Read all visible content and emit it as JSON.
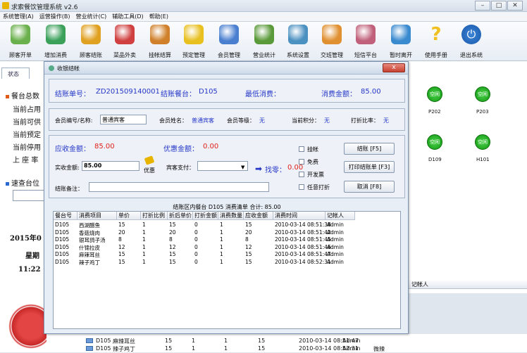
{
  "window": {
    "title": "求索餐饮管理系统 v2.6"
  },
  "menu": [
    "系统管理(A)",
    "运营操作(B)",
    "营业统计(C)",
    "辅助工具(D)",
    "帮助(E)"
  ],
  "toolbar": [
    {
      "label": "顾客开单",
      "icon": "open-order-icon",
      "color": "#6ab04c"
    },
    {
      "label": "增加消费",
      "icon": "add-consumption-icon",
      "color": "#3aa05a"
    },
    {
      "label": "顾客结账",
      "icon": "checkout-coins-icon",
      "color": "#e0a020"
    },
    {
      "label": "菜品外卖",
      "icon": "takeout-icon",
      "color": "#d04040"
    },
    {
      "label": "挂帐结算",
      "icon": "credit-card-icon",
      "color": "#d0802a"
    },
    {
      "label": "预定管理",
      "icon": "reservation-icon",
      "color": "#e8c020"
    },
    {
      "label": "会员管理",
      "icon": "members-icon",
      "color": "#4a7fd0"
    },
    {
      "label": "营业统计",
      "icon": "statistics-chart-icon",
      "color": "#5a9a3a"
    },
    {
      "label": "系统设置",
      "icon": "settings-icon",
      "color": "#4a90c0"
    },
    {
      "label": "交班管理",
      "icon": "shift-handover-icon",
      "color": "#e09030"
    },
    {
      "label": "短信平台",
      "icon": "sms-icon",
      "color": "#c0607a"
    },
    {
      "label": "暂时离开",
      "icon": "away-person-icon",
      "color": "#3a8ad0"
    },
    {
      "label": "使用手册",
      "icon": "help-manual-icon",
      "color": "#f0c020"
    },
    {
      "label": "退出系统",
      "icon": "power-exit-icon",
      "color": "#2a70c8"
    }
  ],
  "left_panel": {
    "tab": "状态",
    "items": [
      "餐台总数",
      "当前占用",
      "当前可供",
      "当前预定",
      "当前停用",
      "上 座 率"
    ],
    "quick_search": "速查台位",
    "date": "2015年0",
    "weekday": "星期",
    "time": "11:22"
  },
  "tables": [
    {
      "name": "P202",
      "status": "空闲"
    },
    {
      "name": "P203",
      "status": "空闲"
    },
    {
      "name": "D109",
      "status": "空闲"
    },
    {
      "name": "H101",
      "status": "空闲"
    }
  ],
  "bg_grid_header": "记帐人",
  "bg_rows": [
    {
      "table": "D105",
      "item": "麻辣耳丝",
      "price": "15",
      "ratio": "1",
      "qty": "1",
      "amount": "15",
      "time": "2010-03-14 08:51:47",
      "who": "Admin",
      "note": ""
    },
    {
      "table": "D105",
      "item": "辣子鸡丁",
      "price": "15",
      "ratio": "1",
      "qty": "1",
      "amount": "15",
      "time": "2010-03-14 08:52:31",
      "who": "Admin",
      "note": "微辣"
    }
  ],
  "dialog": {
    "title": "收银结帐",
    "close": "x",
    "bill_no_label": "结账单号：",
    "bill_no": "ZD201509140001",
    "table_label": "结账餐台：",
    "table": "D105",
    "min_label": "最低消费：",
    "min_value": "",
    "total_label": "消费金额：",
    "total": "85.00",
    "member_id_label": "会员编号/名称:",
    "member_id": "普通宾客",
    "member_name_label": "会员姓名：",
    "member_name": "普通宾客",
    "member_level_label": "会员等级：",
    "member_level": "无",
    "points_label": "当前积分：",
    "points": "无",
    "discount_label": "打折比率：",
    "discount": "无",
    "due_label": "应收金额：",
    "due": "85.00",
    "coupon_label": "优惠金额：",
    "coupon": "0.00",
    "paid_label": "实收金额:",
    "paid": "85.00",
    "coupon_btn": "优惠",
    "guest_pay_label": "宾客支付：",
    "guest_pay": "",
    "change_label": "找零：",
    "change": "0.00",
    "note_label": "结账备注：",
    "note": "",
    "checks": [
      "挂帐",
      "免费",
      "开发票",
      "任意打折"
    ],
    "btn_settle": "结账 [F5]",
    "btn_print": "打印结账单 [F3]",
    "btn_cancel": "取消 [F8]",
    "grid_caption": "结账区内餐台 D105 消费清单 合计: 85.00",
    "grid_columns": [
      "餐台号",
      "消费项目",
      "单价",
      "打折比例",
      "折后单价",
      "打折金额",
      "消费数量",
      "应收金额",
      "消费时间",
      "记帐人"
    ],
    "rows": [
      [
        "D105",
        "西湖醋鱼",
        "15",
        "1",
        "15",
        "0",
        "1",
        "15",
        "2010-03-14 08:51:38",
        "Admin"
      ],
      [
        "D105",
        "香菇烧肉",
        "20",
        "1",
        "20",
        "0",
        "1",
        "20",
        "2010-03-14 08:51:42",
        "Admin"
      ],
      [
        "D105",
        "银耳鸽子汤",
        "8",
        "1",
        "8",
        "0",
        "1",
        "8",
        "2010-03-14 08:51:45",
        "Admin"
      ],
      [
        "D105",
        "什锦拉皮",
        "12",
        "1",
        "12",
        "0",
        "1",
        "12",
        "2010-03-14 08:51:46",
        "Admin"
      ],
      [
        "D105",
        "麻辣耳丝",
        "15",
        "1",
        "15",
        "0",
        "1",
        "15",
        "2010-03-14 08:51:47",
        "Admin"
      ],
      [
        "D105",
        "辣子鸡丁",
        "15",
        "1",
        "15",
        "0",
        "1",
        "15",
        "2010-03-14 08:52:31",
        "Admin"
      ]
    ]
  }
}
